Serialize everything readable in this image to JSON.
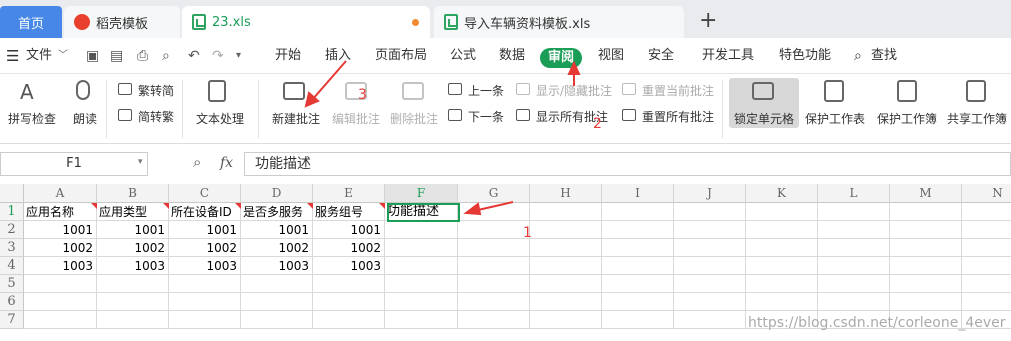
{
  "tabs": [
    {
      "label": "首页"
    },
    {
      "label": "稻壳模板"
    },
    {
      "label": "23.xls"
    },
    {
      "label": "导入车辆资料模板.xls"
    }
  ],
  "tab_add": "+",
  "menu": {
    "file": "文件",
    "start": "开始",
    "insert": "插入",
    "layout": "页面布局",
    "formula": "公式",
    "data": "数据",
    "review": "审阅",
    "view": "视图",
    "security": "安全",
    "dev": "开发工具",
    "special": "特色功能",
    "search": "查找"
  },
  "ribbon": {
    "spell": "拼写检查",
    "read": "朗读",
    "trad": "繁转简",
    "simp": "简转繁",
    "textproc": "文本处理",
    "new_comment": "新建批注",
    "edit_comment": "编辑批注",
    "del_comment": "删除批注",
    "prev": "上一条",
    "next": "下一条",
    "show_hide": "显示/隐藏批注",
    "show_all": "显示所有批注",
    "reset_cur": "重置当前批注",
    "reset_all": "重置所有批注",
    "lock_cell": "锁定单元格",
    "protect_sheet": "保护工作表",
    "protect_book": "保护工作簿",
    "share_book": "共享工作簿"
  },
  "namebox": "F1",
  "fx_label": "fx",
  "formula_value": "功能描述",
  "columns": [
    "A",
    "B",
    "C",
    "D",
    "E",
    "F",
    "G",
    "H",
    "I",
    "J",
    "K",
    "L",
    "M",
    "N"
  ],
  "rows": [
    "1",
    "2",
    "3",
    "4",
    "5",
    "6",
    "7"
  ],
  "header_row": [
    "应用名称",
    "应用类型",
    "所在设备ID",
    "是否多服务",
    "服务组号",
    "功能描述"
  ],
  "data_rows": [
    [
      "1001",
      "1001",
      "1001",
      "1001",
      "1001"
    ],
    [
      "1002",
      "1002",
      "1002",
      "1002",
      "1002"
    ],
    [
      "1003",
      "1003",
      "1003",
      "1003",
      "1003"
    ]
  ],
  "annotations": {
    "n1": "1",
    "n2": "2",
    "n3": "3"
  },
  "watermark": "https://blog.csdn.net/corleone_4ever",
  "colors": {
    "accent": "#1a9d57",
    "home_tab": "#4787e7",
    "annotation": "#e53935"
  }
}
